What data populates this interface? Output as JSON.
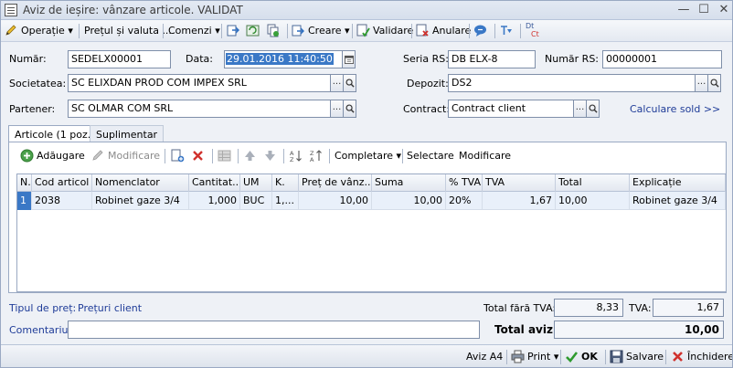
{
  "window": {
    "title": "Aviz de ieșire: vânzare articole. VALIDAT",
    "minimize": "—",
    "maximize": "☐",
    "close": "✕"
  },
  "toolbar": {
    "operatie": "Operație",
    "pret_valuta": "Prețul și valuta ...",
    "comenzi": "Comenzi",
    "creare": "Creare",
    "validare": "Validare",
    "anulare": "Anulare",
    "dt": "Dt",
    "ct": "Ct"
  },
  "form": {
    "numar_label": "Număr:",
    "numar_value": "SEDELX00001",
    "data_label": "Data:",
    "data_value": "29.01.2016 11:40:50",
    "serie_label": "Seria RS:",
    "serie_value": "DB ELX-8",
    "numar_rs_label": "Număr RS:",
    "numar_rs_value": "00000001",
    "societatea_label": "Societatea:",
    "societatea_value": "SC ELIXDAN PROD COM IMPEX SRL",
    "depozit_label": "Depozit:",
    "depozit_value": "DS2",
    "partener_label": "Partener:",
    "partener_value": "SC OLMAR COM SRL",
    "contract_label": "Contract:",
    "contract_value": "Contract client",
    "calculare_sold": "Calculare sold >>",
    "dots": "..."
  },
  "tabs": {
    "articole": "Articole (1 poz.)",
    "suplimentar": "Suplimentar"
  },
  "grid_toolbar": {
    "adaugare": "Adăugare",
    "modificare": "Modificare",
    "completare": "Completare",
    "selectare": "Selectare",
    "modificare2": "Modificare"
  },
  "grid": {
    "headers": [
      "N.",
      "Cod articol",
      "Nomenclator",
      "Cantitat...",
      "UM",
      "K.",
      "Preț de vânz...",
      "Suma",
      "% TVA",
      "TVA",
      "Total",
      "Explicație"
    ],
    "rows": [
      [
        "1",
        "2038",
        "Robinet gaze 3/4",
        "1,000",
        "BUC",
        "1,...",
        "10,00",
        "10,00",
        "20%",
        "1,67",
        "10,00",
        "Robinet gaze 3/4"
      ]
    ]
  },
  "footer": {
    "tip_pret_label": "Tipul de preț:",
    "tip_pret_value": "Prețuri client",
    "total_fara_tva_label": "Total fără TVA:",
    "total_fara_tva_value": "8,33",
    "tva_label": "TVA:",
    "tva_value": "1,67",
    "comentariu_label": "Comentariu:",
    "comentariu_value": "",
    "total_aviz_label": "Total aviz:",
    "total_aviz_value": "10,00"
  },
  "bottombar": {
    "aviz_a4": "Aviz A4",
    "print": "Print",
    "ok": "OK",
    "salvare": "Salvare",
    "inchidere": "Închidere"
  },
  "colors": {
    "accent_blue": "#3a78c6",
    "link_blue": "#1f3c98",
    "delete_red": "#d0312d",
    "ok_green": "#2e9a2e"
  }
}
